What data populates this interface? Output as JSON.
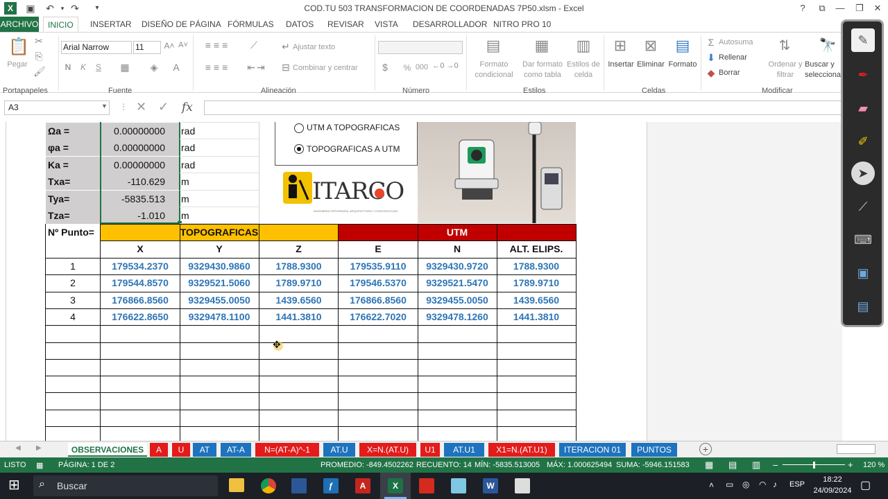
{
  "window": {
    "title": "COD.TU 503 TRANSFORMACION DE COORDENADAS 7P50.xlsm - Excel",
    "help": "?"
  },
  "tabs": [
    "ARCHIVO",
    "INICIO",
    "INSERTAR",
    "DISEÑO DE PÁGINA",
    "FÓRMULAS",
    "DATOS",
    "REVISAR",
    "VISTA",
    "DESARROLLADOR",
    "NITRO PRO 10"
  ],
  "ribbon": {
    "groups": [
      "Portapapeles",
      "Fuente",
      "Alineación",
      "Número",
      "Estilos",
      "Celdas",
      "Modificar"
    ],
    "paste": "Pegar",
    "font_name": "Arial Narrow",
    "font_size": "11",
    "wrap_text": "Ajustar texto",
    "merge_center": "Combinar y centrar",
    "cond_format": [
      "Formato",
      "condicional"
    ],
    "table_format": [
      "Dar formato",
      "como tabla"
    ],
    "cell_styles": [
      "Estilos de",
      "celda"
    ],
    "insert": "Insertar",
    "delete": "Eliminar",
    "format": "Formato",
    "autosum": "Autosuma",
    "fill": "Rellenar",
    "clear": "Borrar",
    "sort": [
      "Ordenar y",
      "filtrar"
    ],
    "find": [
      "Buscar y",
      "selecciona"
    ],
    "num_pct": "%",
    "num_000": "000",
    "font_b": "N",
    "font_i": "K",
    "font_u": "S"
  },
  "formula_bar": {
    "name_box": "A3",
    "fx": "fx"
  },
  "params": [
    {
      "label": "Ωa =",
      "value": "0.00000000",
      "unit": "rad"
    },
    {
      "label": "φa =",
      "value": "0.00000000",
      "unit": "rad"
    },
    {
      "label": "Ka =",
      "value": "0.00000000",
      "unit": "rad"
    },
    {
      "label": "Txa=",
      "value": "-110.629",
      "unit": "m"
    },
    {
      "label": "Tya=",
      "value": "-5835.513",
      "unit": "m"
    },
    {
      "label": "Tza=",
      "value": "-1.010",
      "unit": "m"
    }
  ],
  "options": [
    "UTM A TOPOGRAFICAS",
    "TOPOGRAFICAS A UTM"
  ],
  "logo_text": "ITARCO",
  "logo_sub": "INGENIERIA TOPOGRAFIA, ARQUITECTURA Y CONSTRUCCION",
  "table": {
    "point_header": "Nº Punto=",
    "group_topo": "TOPOGRAFICAS",
    "group_utm": "UTM",
    "columns": [
      "X",
      "Y",
      "Z",
      "E",
      "N",
      "ALT. ELIPS."
    ],
    "rows": [
      {
        "n": "1",
        "vals": [
          "179534.2370",
          "9329430.9860",
          "1788.9300",
          "179535.9110",
          "9329430.9720",
          "1788.9300"
        ]
      },
      {
        "n": "2",
        "vals": [
          "179544.8570",
          "9329521.5060",
          "1789.9710",
          "179546.5370",
          "9329521.5470",
          "1789.9710"
        ]
      },
      {
        "n": "3",
        "vals": [
          "176866.8560",
          "9329455.0050",
          "1439.6560",
          "176866.8560",
          "9329455.0050",
          "1439.6560"
        ]
      },
      {
        "n": "4",
        "vals": [
          "176622.8650",
          "9329478.1100",
          "1441.3810",
          "176622.7020",
          "9329478.1260",
          "1441.3810"
        ]
      }
    ]
  },
  "sheet_tabs": [
    {
      "label": "OBSERVACIONES",
      "color": "#ffffff"
    },
    {
      "label": "A",
      "color": "#e31b1b"
    },
    {
      "label": "U",
      "color": "#e31b1b"
    },
    {
      "label": "AT",
      "color": "#1e73be"
    },
    {
      "label": "AT-A",
      "color": "#1e73be"
    },
    {
      "label": "N=(AT-A)^-1",
      "color": "#e31b1b"
    },
    {
      "label": "AT.U",
      "color": "#1e73be"
    },
    {
      "label": "X=N.(AT.U)",
      "color": "#e31b1b"
    },
    {
      "label": "U1",
      "color": "#e31b1b"
    },
    {
      "label": "AT.U1",
      "color": "#1e73be"
    },
    {
      "label": "X1=N.(AT.U1)",
      "color": "#e31b1b"
    },
    {
      "label": "ITERACION 01",
      "color": "#1e73be"
    },
    {
      "label": "PUNTOS",
      "color": "#1e73be"
    }
  ],
  "status": {
    "mode": "LISTO",
    "page": "PÁGINA: 1 DE 2",
    "avg": "PROMEDIO: -849.4502262",
    "count": "RECUENTO: 14",
    "min": "MÍN: -5835.513005",
    "max": "MÁX: 1.000625494",
    "sum": "SUMA: -5946.151583",
    "zoom": "120 %"
  },
  "taskbar": {
    "search": "Buscar",
    "lang": "ESP",
    "time": "18:22",
    "date": "24/09/2024"
  },
  "colors": {
    "excel_green": "#217346",
    "topo_header": "#ffc000",
    "utm_header": "#c00000",
    "data_blue": "#2e75b6"
  }
}
